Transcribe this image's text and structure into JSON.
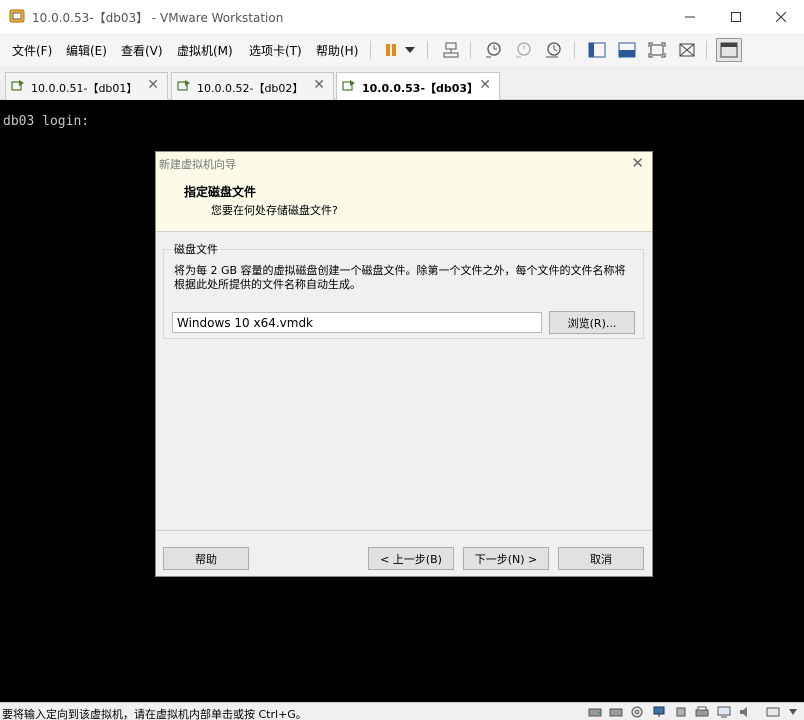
{
  "window": {
    "title": "10.0.0.53-【db03】 - VMware Workstation"
  },
  "menu": {
    "items": [
      "文件(F)",
      "编辑(E)",
      "查看(V)",
      "虚拟机(M)",
      "选项卡(T)",
      "帮助(H)"
    ]
  },
  "toolbar_icons": [
    "pause-icon",
    "dropdown-arrow-icon",
    "send-keys-icon",
    "snapshot-take-icon",
    "snapshot-revert-icon",
    "snapshot-manager-icon",
    "library-icon",
    "console-view-icon",
    "fullscreen-icon",
    "unity-icon",
    "thumbnail-icon"
  ],
  "tabs": [
    {
      "label": "10.0.0.51-【db01】",
      "active": false
    },
    {
      "label": "10.0.0.52-【db02】",
      "active": false
    },
    {
      "label": "10.0.0.53-【db03】",
      "active": true
    }
  ],
  "console": {
    "text": "db03 login:"
  },
  "dialog": {
    "title": "新建虚拟机向导",
    "heading": "指定磁盘文件",
    "subheading": "您要在何处存储磁盘文件?",
    "group_label": "磁盘文件",
    "description": "将为每 2 GB 容量的虚拟磁盘创建一个磁盘文件。除第一个文件之外，每个文件的文件名称将根据此处所提供的文件名称自动生成。",
    "file_value": "Windows 10 x64.vmdk",
    "browse_label": "浏览(R)...",
    "help_label": "帮助",
    "back_label": "< 上一步(B)",
    "next_label": "下一步(N) >",
    "cancel_label": "取消"
  },
  "statusbar": {
    "text": "要将输入定向到该虚拟机，请在虚拟机内部单击或按 Ctrl+G。"
  },
  "colors": {
    "console_bg": "#000000",
    "dialog_header_bg": "#fbfbe8",
    "pause_orange": "#e8891c"
  }
}
